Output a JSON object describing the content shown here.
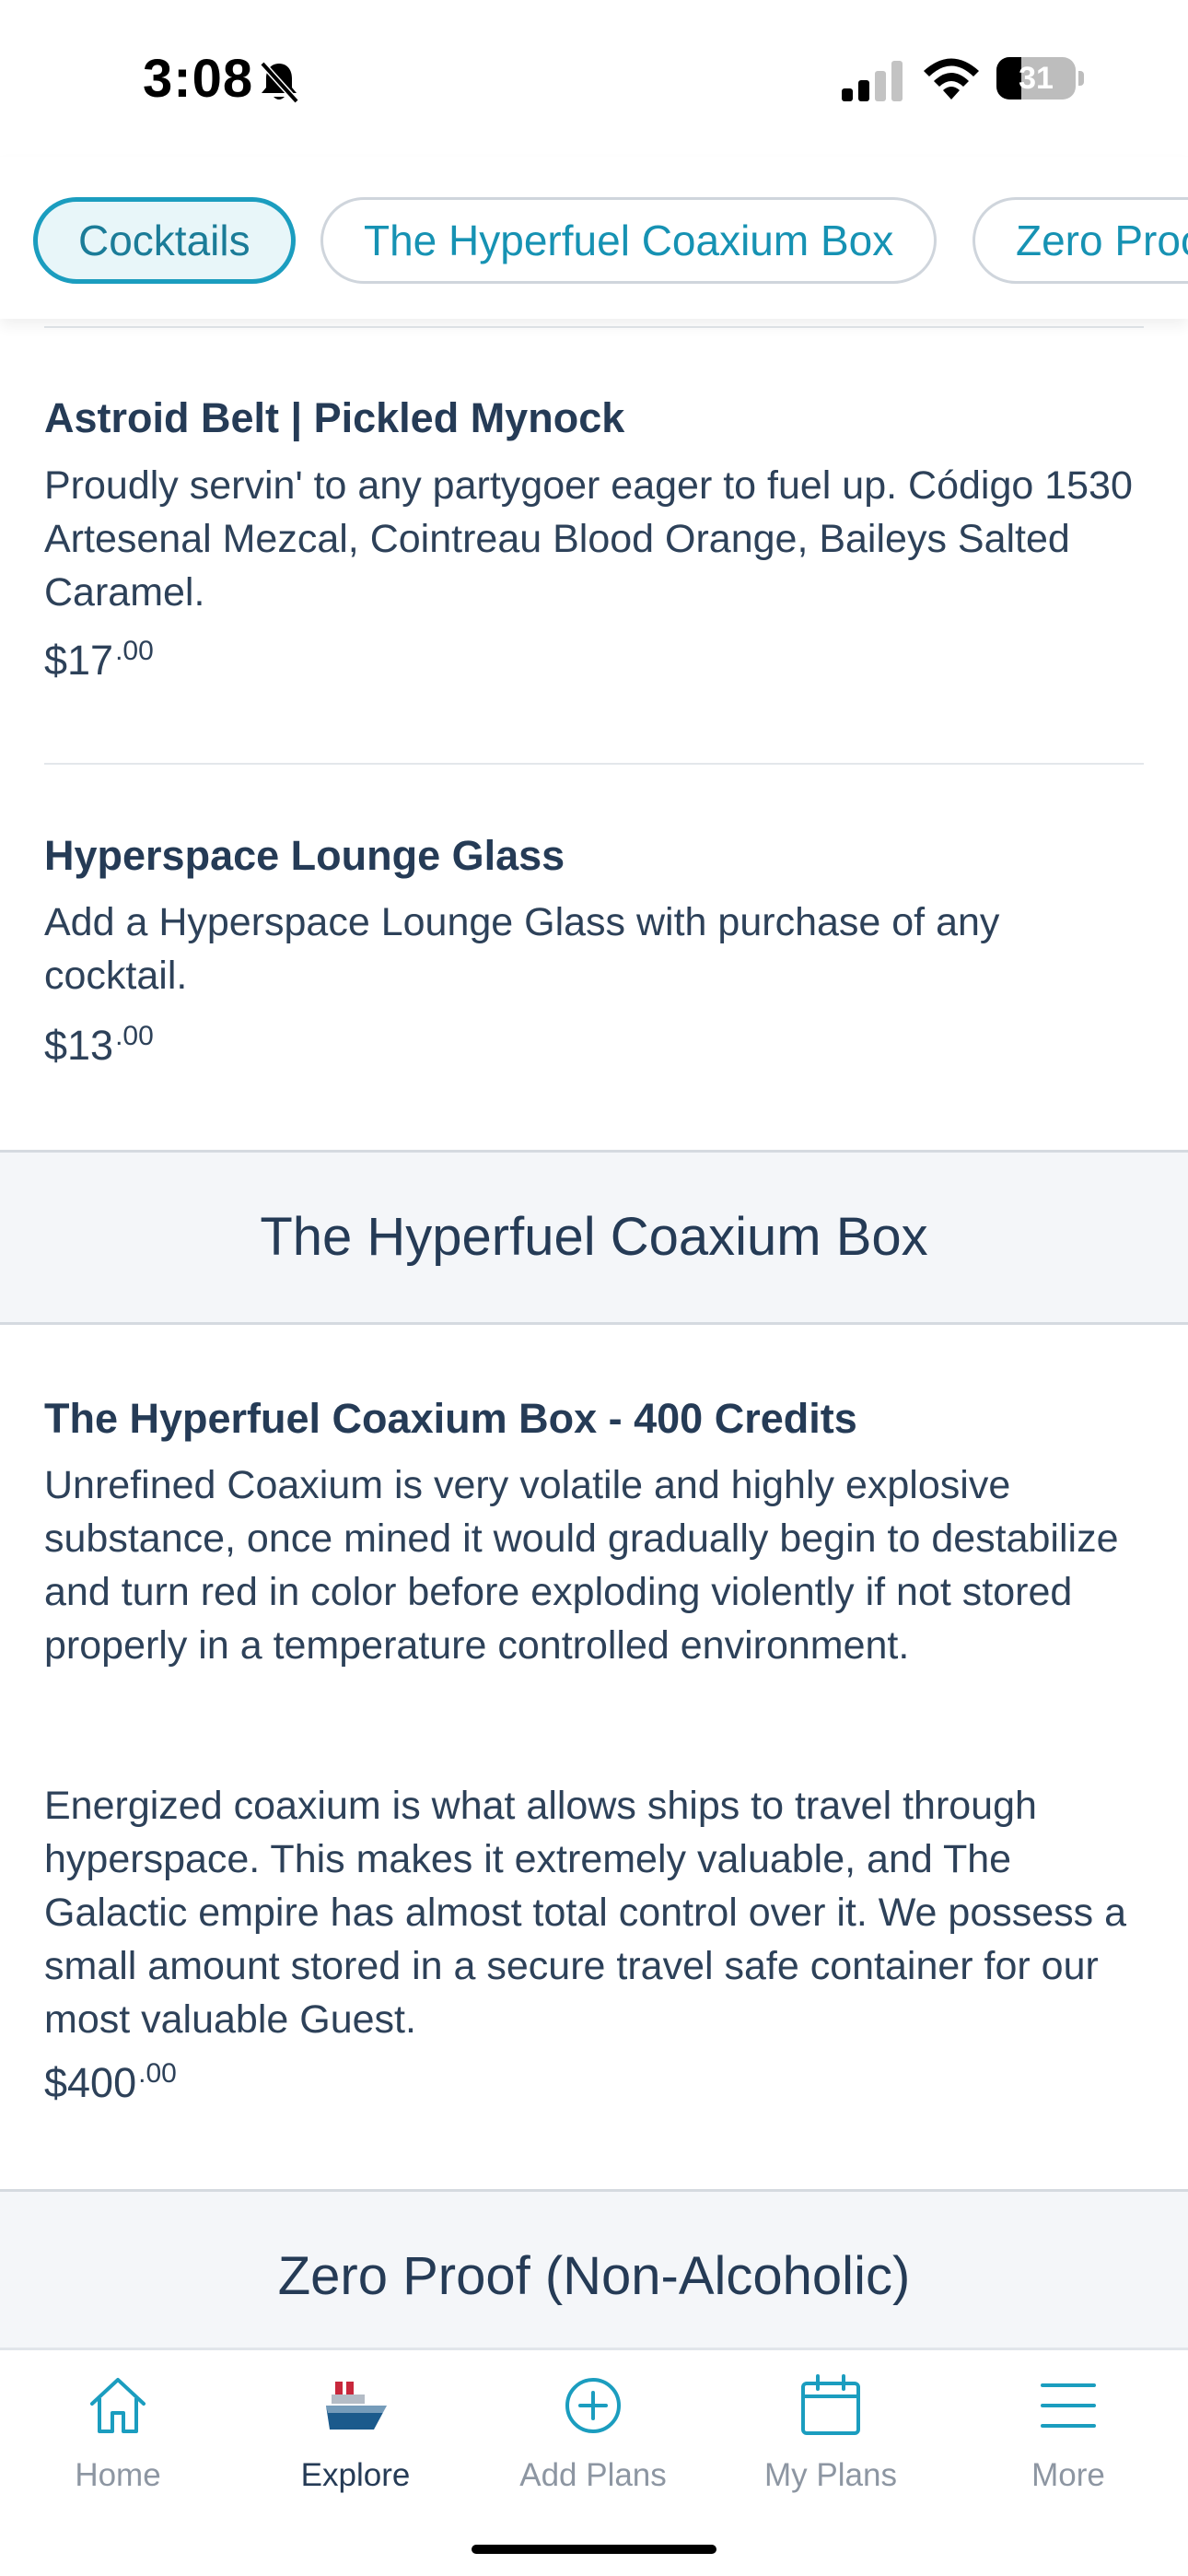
{
  "status_bar": {
    "time": "3:08",
    "battery": "31",
    "battery_level": 0.31
  },
  "tabs": [
    {
      "label": "Cocktails",
      "active": true
    },
    {
      "label": "The Hyperfuel Coaxium Box",
      "active": false
    },
    {
      "label": "Zero Proof (Non-Alcoholic)",
      "active": false
    }
  ],
  "items": [
    {
      "title": "Astroid Belt | Pickled Mynock",
      "description": "Proudly servin' to any partygoer eager to fuel up. Código 1530 Artesenal Mezcal, Cointreau Blood Orange, Baileys Salted Caramel.",
      "price_dollars": "$17",
      "price_cents": ".00"
    },
    {
      "title": "Hyperspace Lounge Glass",
      "description": "Add a Hyperspace Lounge Glass with purchase of any cocktail.",
      "price_dollars": "$13",
      "price_cents": ".00"
    }
  ],
  "sections": [
    {
      "title": "The Hyperfuel Coaxium Box",
      "items": [
        {
          "title": "The Hyperfuel Coaxium Box - 400 Credits",
          "description_1": "Unrefined Coaxium is very volatile and highly explosive substance, once mined it would gradually begin to destabilize and turn red in color before exploding violently if not stored properly in a temperature controlled environment.",
          "description_2": "Energized coaxium is what allows ships to travel through hyperspace. This makes it extremely valuable, and The Galactic empire has almost total control over it. We possess a small amount stored in a secure travel safe container for our most valuable Guest.",
          "price_dollars": "$400",
          "price_cents": ".00"
        }
      ]
    },
    {
      "title": "Zero Proof (Non-Alcoholic)"
    }
  ],
  "bottom_nav": [
    {
      "label": "Home",
      "icon": "home-icon",
      "active": false
    },
    {
      "label": "Explore",
      "icon": "ship-icon",
      "active": true
    },
    {
      "label": "Add Plans",
      "icon": "add-circle-icon",
      "active": false
    },
    {
      "label": "My Plans",
      "icon": "calendar-icon",
      "active": false
    },
    {
      "label": "More",
      "icon": "menu-icon",
      "active": false
    }
  ],
  "colors": {
    "accent": "#1b9dbf",
    "text_dark": "#253b56",
    "nav_inactive": "#8d96a2",
    "section_bg": "#f4f6f9"
  }
}
